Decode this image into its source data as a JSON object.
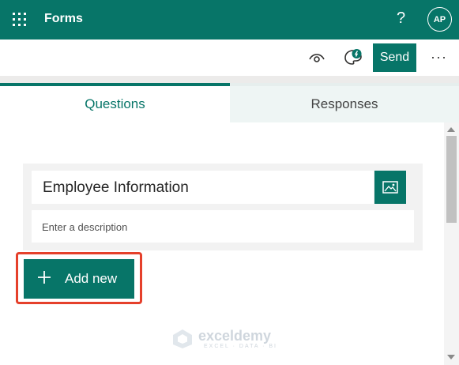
{
  "topbar": {
    "app_name": "Forms",
    "help_label": "?",
    "avatar_initials": "AP",
    "color": "#077568"
  },
  "toolbar": {
    "preview_icon": "eye-icon",
    "theme_icon": "palette-icon",
    "send_label": "Send",
    "more_label": "···"
  },
  "tabs": [
    {
      "label": "Questions",
      "active": true
    },
    {
      "label": "Responses",
      "active": false
    }
  ],
  "form": {
    "title": "Employee Information",
    "description_placeholder": "Enter a description",
    "image_icon": "image-icon"
  },
  "actions": {
    "add_new_label": "Add new",
    "highlight_color": "#e5402b"
  },
  "watermark": {
    "name": "exceldemy",
    "tagline": "EXCEL · DATA · BI"
  }
}
